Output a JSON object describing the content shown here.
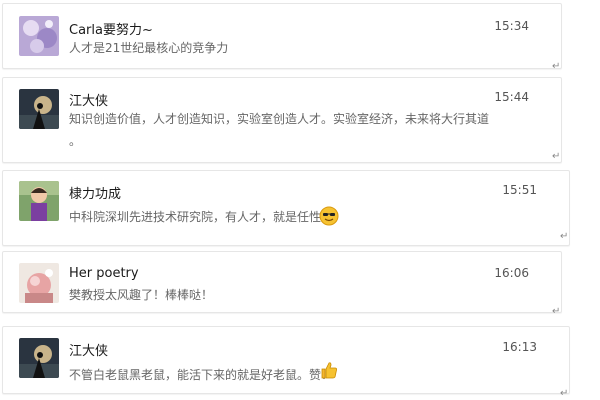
{
  "messages": [
    {
      "name": "Carla要努力~",
      "time": "15:34",
      "text": "人才是21世纪最核心的竞争力",
      "cont": ""
    },
    {
      "name": "江大侠",
      "time": "15:44",
      "text": "知识创造价值，人才创造知识，实验室创造人才。实验室经济，未来将大行其道",
      "cont": "。"
    },
    {
      "name": "棣力功成",
      "time": "15:51",
      "text": "中科院深圳先进技术研究院，有人才，就是任性！",
      "cont": ""
    },
    {
      "name": "Her poetry",
      "time": "16:06",
      "text": "樊教授太风趣了！棒棒哒！",
      "cont": ""
    },
    {
      "name": "江大侠",
      "time": "16:13",
      "text": "不管白老鼠黑老鼠，能活下来的就是好老鼠。赞！",
      "cont": ""
    }
  ],
  "return_mark": "↵",
  "icons": [
    "cool-face-emoji-icon",
    "thumbs-up-emoji-icon"
  ]
}
